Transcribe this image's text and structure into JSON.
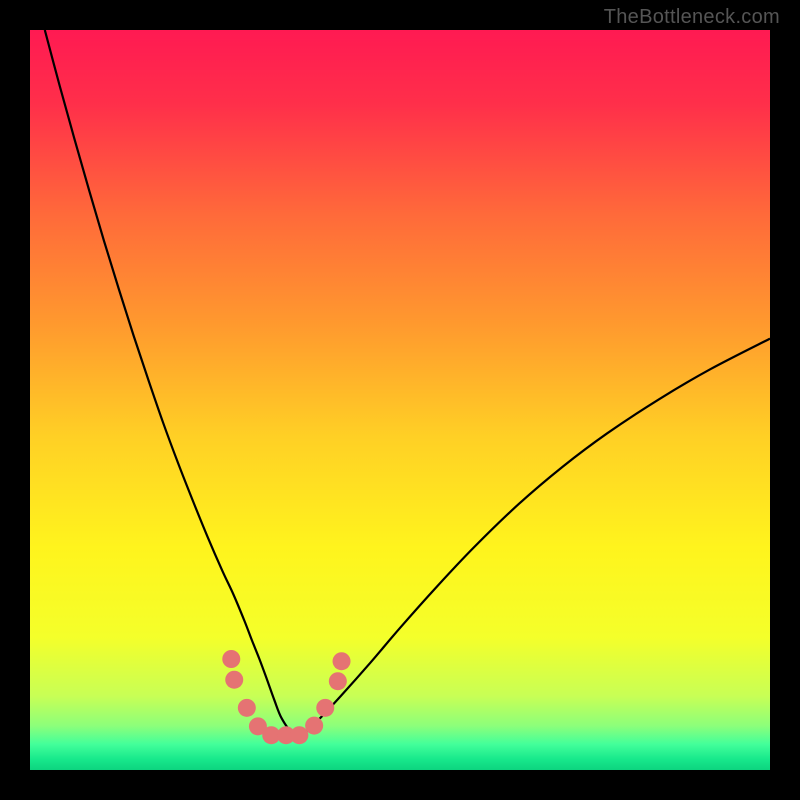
{
  "watermark": "TheBottleneck.com",
  "chart_data": {
    "type": "line",
    "title": "",
    "xlabel": "",
    "ylabel": "",
    "xlim": [
      0,
      100
    ],
    "ylim": [
      0,
      100
    ],
    "gradient_stops": [
      {
        "offset": 0.0,
        "color": "#ff1a52"
      },
      {
        "offset": 0.1,
        "color": "#ff2f4a"
      },
      {
        "offset": 0.25,
        "color": "#ff6a3a"
      },
      {
        "offset": 0.4,
        "color": "#ff9a2e"
      },
      {
        "offset": 0.55,
        "color": "#ffd025"
      },
      {
        "offset": 0.7,
        "color": "#fff41d"
      },
      {
        "offset": 0.82,
        "color": "#f4ff2a"
      },
      {
        "offset": 0.9,
        "color": "#c8ff55"
      },
      {
        "offset": 0.94,
        "color": "#8dff7a"
      },
      {
        "offset": 0.965,
        "color": "#43ff9a"
      },
      {
        "offset": 0.985,
        "color": "#18e98c"
      },
      {
        "offset": 1.0,
        "color": "#0dd47f"
      }
    ],
    "series": [
      {
        "name": "bottleneck-curve",
        "color": "#000000",
        "width": 2.2,
        "x": [
          2,
          4,
          6,
          8,
          10,
          12,
          14,
          16,
          18,
          20,
          22,
          24,
          26,
          27.5,
          29,
          30,
          31,
          32,
          33,
          34,
          35.5,
          37,
          39,
          42,
          46,
          50,
          55,
          60,
          66,
          72,
          78,
          85,
          92,
          100
        ],
        "values": [
          100,
          92.5,
          85.3,
          78.3,
          71.5,
          65,
          58.7,
          52.7,
          46.9,
          41.5,
          36.4,
          31.5,
          26.9,
          23.7,
          20.1,
          17.5,
          15.0,
          12.3,
          9.5,
          7.0,
          5.0,
          5.0,
          6.8,
          10.0,
          14.5,
          19.2,
          24.8,
          30.1,
          35.9,
          41.0,
          45.5,
          50.1,
          54.2,
          58.3
        ]
      }
    ],
    "markers": {
      "name": "highlight-dots",
      "color": "#e57373",
      "radius": 9,
      "points": [
        {
          "x": 27.2,
          "y": 15.0
        },
        {
          "x": 27.6,
          "y": 12.2
        },
        {
          "x": 29.3,
          "y": 8.4
        },
        {
          "x": 30.8,
          "y": 5.9
        },
        {
          "x": 32.6,
          "y": 4.7
        },
        {
          "x": 34.6,
          "y": 4.7
        },
        {
          "x": 36.4,
          "y": 4.7
        },
        {
          "x": 38.4,
          "y": 6.0
        },
        {
          "x": 39.9,
          "y": 8.4
        },
        {
          "x": 41.6,
          "y": 12.0
        },
        {
          "x": 42.1,
          "y": 14.7
        }
      ]
    }
  }
}
